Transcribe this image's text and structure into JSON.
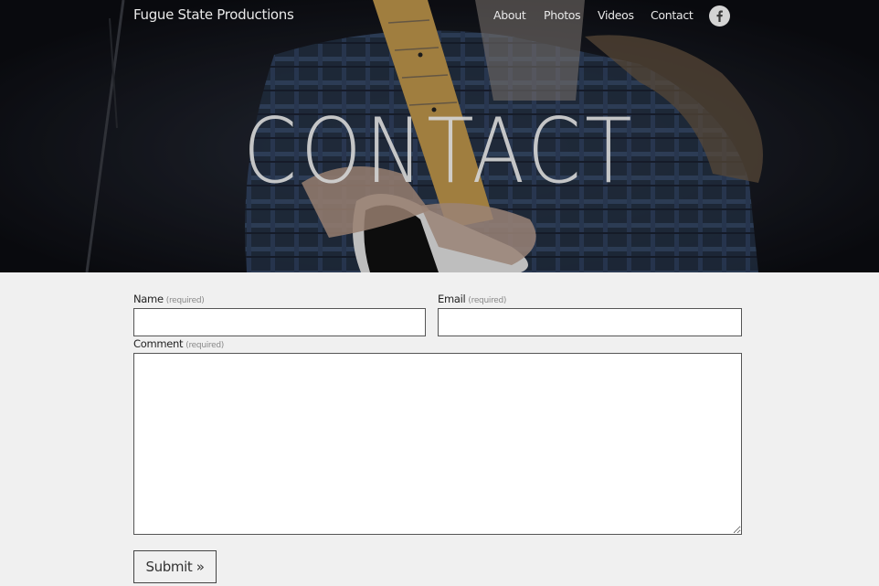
{
  "header": {
    "site_title": "Fugue State Productions",
    "nav": [
      "About",
      "Photos",
      "Videos",
      "Contact"
    ],
    "social_icon": "facebook-icon"
  },
  "hero": {
    "title": "CONTACT",
    "image": "guitarist playing electric guitar in dim light"
  },
  "form": {
    "name_label": "Name",
    "email_label": "Email",
    "comment_label": "Comment",
    "required_note": "(required)",
    "name_value": "",
    "email_value": "",
    "comment_value": "",
    "submit_label": "Submit »"
  },
  "colors": {
    "page_bg": "#f0f0f0",
    "hero_dark": "#14161d",
    "nav_text": "#e9e9e9"
  }
}
